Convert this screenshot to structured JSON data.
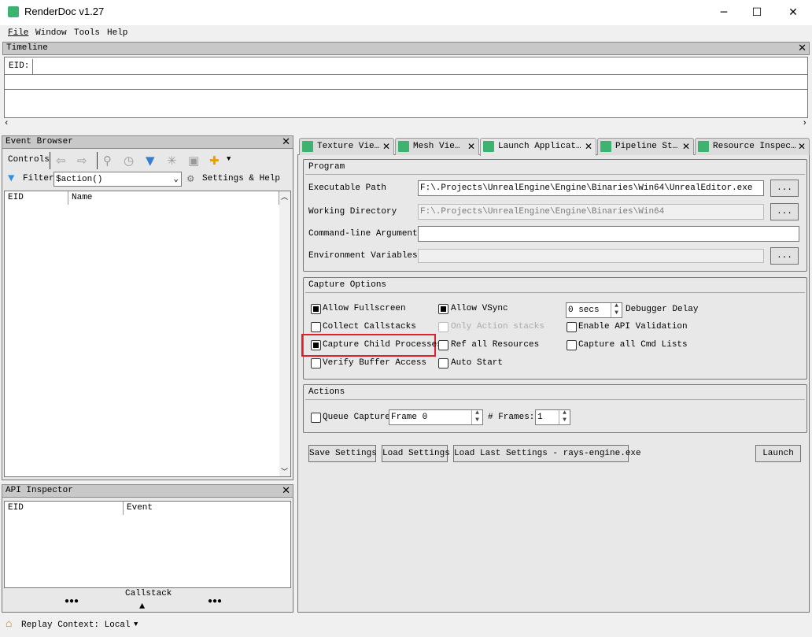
{
  "window": {
    "title": "RenderDoc v1.27",
    "minimize": "─",
    "maximize": "☐",
    "close": "✕"
  },
  "menu": [
    "File",
    "Window",
    "Tools",
    "Help"
  ],
  "timeline": {
    "title": "Timeline",
    "eid_label": "EID:"
  },
  "event_browser": {
    "title": "Event Browser",
    "controls_label": "Controls",
    "filter_label": "Filter",
    "filter_value": "$action()",
    "settings_label": "Settings & Help",
    "columns": [
      "EID",
      "Name"
    ]
  },
  "api_inspector": {
    "title": "API Inspector",
    "columns": [
      "EID",
      "Event"
    ],
    "callstack_label": "Callstack",
    "dots": "●●●"
  },
  "tabs": [
    {
      "label": "Texture Vie…"
    },
    {
      "label": "Mesh Vie…"
    },
    {
      "label": "Launch Applicat…"
    },
    {
      "label": "Pipeline St…"
    },
    {
      "label": "Resource Inspec…"
    }
  ],
  "program": {
    "title": "Program",
    "exe_label": "Executable Path",
    "exe_value": "F:\\.Projects\\UnrealEngine\\Engine\\Binaries\\Win64\\UnrealEditor.exe",
    "workdir_label": "Working Directory",
    "workdir_value": "F:\\.Projects\\UnrealEngine\\Engine\\Binaries\\Win64",
    "args_label": "Command-line Arguments",
    "args_value": "",
    "env_label": "Environment Variables",
    "env_value": "",
    "browse": "..."
  },
  "capture_options": {
    "title": "Capture Options",
    "allow_fullscreen": "Allow Fullscreen",
    "collect_callstacks": "Collect Callstacks",
    "capture_child": "Capture Child Processes",
    "verify_buffer": "Verify Buffer Access",
    "allow_vsync": "Allow VSync",
    "only_action": "Only Action stacks",
    "ref_all": "Ref all Resources",
    "auto_start": "Auto Start",
    "delay_value": "0 secs",
    "delay_label": "Debugger Delay",
    "enable_api": "Enable API Validation",
    "capture_cmd": "Capture all Cmd Lists",
    "highlight_color": "#e0202a"
  },
  "actions": {
    "title": "Actions",
    "queue_label": "Queue Capture",
    "frame_value": "Frame 0",
    "frames_label": "# Frames:",
    "frames_value": "1"
  },
  "buttons": {
    "save": "Save Settings",
    "load": "Load Settings",
    "load_last": "Load Last Settings - rays-engine.exe",
    "launch": "Launch"
  },
  "status": {
    "replay": "Replay Context: Local"
  }
}
